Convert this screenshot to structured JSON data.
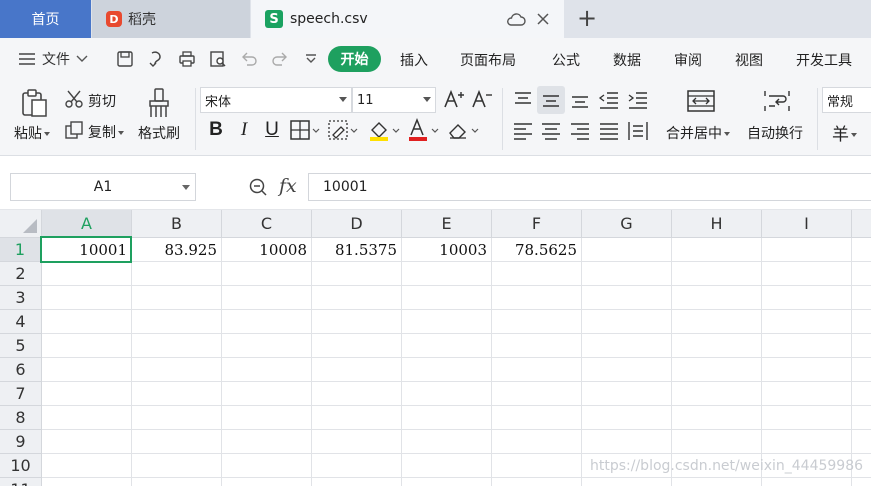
{
  "tabs": {
    "home": "首页",
    "wps": "稻壳",
    "file": "speech.csv",
    "wps_logo_glyph": "D",
    "file_logo_glyph": "S"
  },
  "menu": {
    "file_label": "文件",
    "items": [
      "开始",
      "插入",
      "页面布局",
      "公式",
      "数据",
      "审阅",
      "视图",
      "开发工具"
    ]
  },
  "ribbon": {
    "paste": "粘贴",
    "cut": "剪切",
    "copy": "复制",
    "format_painter": "格式刷",
    "font_name": "宋体",
    "font_size": "11",
    "bold": "B",
    "italic": "I",
    "underline": "U",
    "merge_center": "合并居中",
    "wrap_text": "自动换行",
    "number_format": "常规",
    "currency_glyph": "羊",
    "font_color": "#e02020",
    "fill_color": "#ffe000",
    "accent": "#1ea05f"
  },
  "formula_bar": {
    "cell_ref": "A1",
    "fx": "fx",
    "value": "10001"
  },
  "sheet": {
    "columns": [
      "A",
      "B",
      "C",
      "D",
      "E",
      "F",
      "G",
      "H",
      "I"
    ],
    "rows": [
      "1",
      "2",
      "3",
      "4",
      "5",
      "6",
      "7",
      "8",
      "9",
      "10",
      "11"
    ],
    "row1": [
      "10001",
      "83.925",
      "10008",
      "81.5375",
      "10003",
      "78.5625"
    ]
  },
  "watermark": "https://blog.csdn.net/weixin_44459986"
}
